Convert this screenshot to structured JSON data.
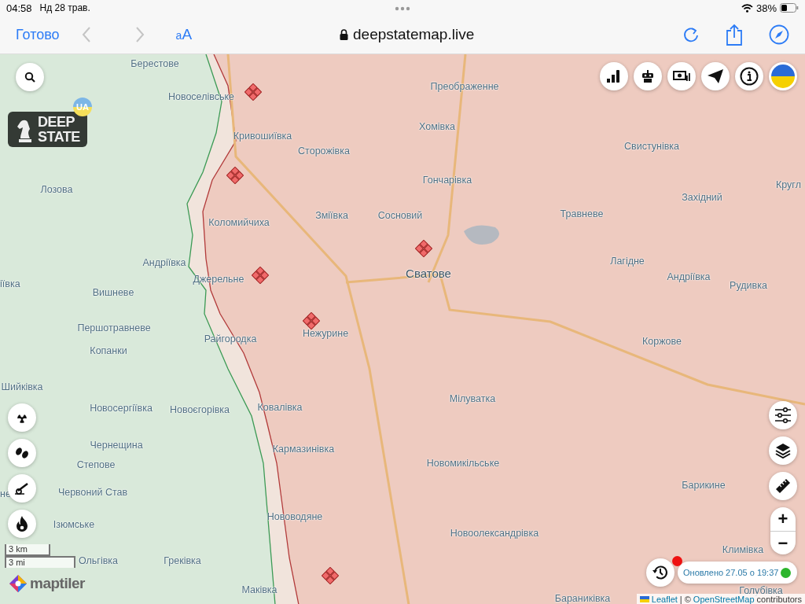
{
  "status_bar": {
    "time": "04:58",
    "date": "Нд 28 трав.",
    "battery": "38%"
  },
  "toolbar": {
    "done": "Готово",
    "back": {
      "disabled": true
    },
    "forward": {
      "disabled": true
    },
    "text_size": "aA",
    "url": "deepstatemap.live"
  },
  "logo": {
    "lines": [
      "DEEP",
      "STATE"
    ],
    "badge": "UA"
  },
  "places": [
    {
      "name": "Берестове",
      "kind": "village"
    },
    {
      "name": "Преображенне",
      "kind": "village"
    },
    {
      "name": "Новоселівське",
      "kind": "village"
    },
    {
      "name": "Хомівка",
      "kind": "village"
    },
    {
      "name": "Кривошиївка",
      "kind": "village"
    },
    {
      "name": "Свистунівка",
      "kind": "village"
    },
    {
      "name": "Сторожівка",
      "kind": "village"
    },
    {
      "name": "Лозова",
      "kind": "village"
    },
    {
      "name": "Гончарівка",
      "kind": "village"
    },
    {
      "name": "Західний",
      "kind": "village"
    },
    {
      "name": "Кругл",
      "kind": "village"
    },
    {
      "name": "Коломийчиха",
      "kind": "village"
    },
    {
      "name": "Зміївка",
      "kind": "village"
    },
    {
      "name": "Сосновий",
      "kind": "village"
    },
    {
      "name": "Травневе",
      "kind": "village"
    },
    {
      "name": "Андріївка",
      "kind": "village"
    },
    {
      "name": "Лагідне",
      "kind": "village"
    },
    {
      "name": "іївка",
      "kind": "village"
    },
    {
      "name": "Джерельне",
      "kind": "village"
    },
    {
      "name": "Сватове",
      "kind": "town"
    },
    {
      "name": "Андріївка",
      "kind": "village"
    },
    {
      "name": "Рудивка",
      "kind": "village"
    },
    {
      "name": "Вишневе",
      "kind": "village"
    },
    {
      "name": "Першотравневе",
      "kind": "village"
    },
    {
      "name": "Райгородка",
      "kind": "village"
    },
    {
      "name": "Нежурине",
      "kind": "village"
    },
    {
      "name": "Коржове",
      "kind": "village"
    },
    {
      "name": "Копанки",
      "kind": "village"
    },
    {
      "name": "Шийківка",
      "kind": "village"
    },
    {
      "name": "Мілуватка",
      "kind": "village"
    },
    {
      "name": "Новосергіївка",
      "kind": "village"
    },
    {
      "name": "Новоєгорівка",
      "kind": "village"
    },
    {
      "name": "Ковалівка",
      "kind": "village"
    },
    {
      "name": "Чернещина",
      "kind": "village"
    },
    {
      "name": "Кармазинівка",
      "kind": "village"
    },
    {
      "name": "Степове",
      "kind": "village"
    },
    {
      "name": "Новомикільське",
      "kind": "village"
    },
    {
      "name": "Барикине",
      "kind": "village"
    },
    {
      "name": "не",
      "kind": "village"
    },
    {
      "name": "Червоний Став",
      "kind": "village"
    },
    {
      "name": "Ізюмське",
      "kind": "village"
    },
    {
      "name": "Нововодяне",
      "kind": "village"
    },
    {
      "name": "Новоолександрівка",
      "kind": "village"
    },
    {
      "name": "Климівка",
      "kind": "village"
    },
    {
      "name": "Ольгівка",
      "kind": "village"
    },
    {
      "name": "Греківка",
      "kind": "village"
    },
    {
      "name": "Маківка",
      "kind": "village"
    },
    {
      "name": "Бараниківка",
      "kind": "village"
    },
    {
      "name": "Голубівка",
      "kind": "village"
    }
  ],
  "scale": {
    "km": "3 km",
    "mi": "3 mi"
  },
  "maptiler": "maptiler",
  "zoom": {
    "in": "+",
    "out": "−"
  },
  "update": {
    "text": "Оновлено 27.05 о 19:37"
  },
  "attribution": {
    "leaflet": "Leaflet",
    "separator": "| ©",
    "osm": "OpenStreetMap",
    "rest": "contributors"
  }
}
